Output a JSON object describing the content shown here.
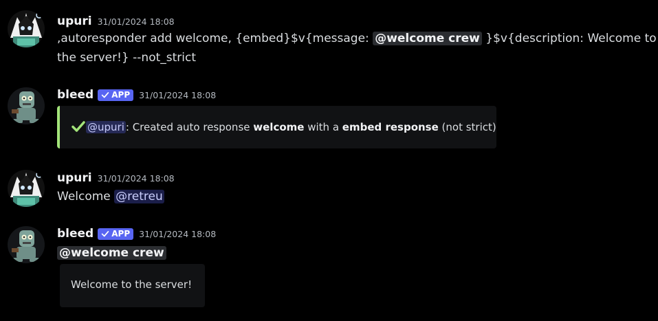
{
  "messages": [
    {
      "author": "upuri",
      "timestamp": "31/01/2024 18:08",
      "avatar_icon": "anime-character-avatar-icon",
      "content": {
        "part1": ",autoresponder add welcome, {embed}$v{message: ",
        "mention": "@welcome crew",
        "part2": " }$v{description: Welcome to",
        "line2": "the server!} --not_strict"
      }
    },
    {
      "author": "bleed",
      "badge": "APP",
      "timestamp": "31/01/2024 18:08",
      "avatar_icon": "robot-avatar-icon",
      "embed": {
        "accent_color": "#a3e47a",
        "icon": "check-icon",
        "mention": "@upuri",
        "text1": ": Created auto response ",
        "bold1": "welcome",
        "text2": " with a ",
        "bold2": "embed response",
        "text3": " (not strict)"
      }
    },
    {
      "author": "upuri",
      "timestamp": "31/01/2024 18:08",
      "avatar_icon": "anime-character-avatar-icon",
      "content": {
        "text": "Welcome ",
        "mention": "@retreu"
      }
    },
    {
      "author": "bleed",
      "badge": "APP",
      "timestamp": "31/01/2024 18:08",
      "avatar_icon": "robot-avatar-icon",
      "content": {
        "mention": "@welcome crew"
      },
      "embed": {
        "description": "Welcome to the server!"
      }
    }
  ],
  "colors": {
    "background": "#000000",
    "app_badge": "#5865f2",
    "success_accent": "#a3e47a",
    "mention_text": "#c9cdfb"
  }
}
